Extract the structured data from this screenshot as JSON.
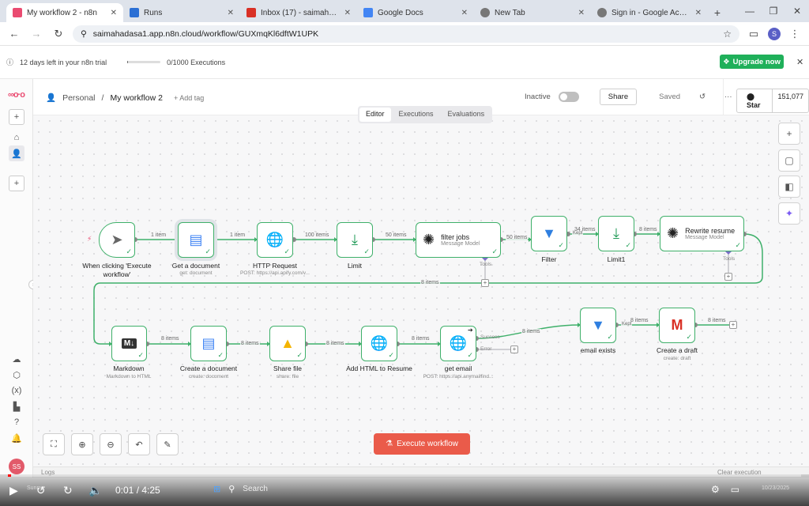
{
  "browser": {
    "tabs": [
      {
        "label": "My workflow 2 - n8n",
        "color": "#ea4b71",
        "active": true
      },
      {
        "label": "Runs",
        "color": "#2b6fd4",
        "active": false
      },
      {
        "label": "Inbox (17) - saimahadasa74",
        "color": "#d93025",
        "active": false
      },
      {
        "label": "Google Docs",
        "color": "#4285f4",
        "active": false
      },
      {
        "label": "New Tab",
        "color": "#777777",
        "active": false
      },
      {
        "label": "Sign in - Google Accounts",
        "color": "#777777",
        "active": false
      }
    ],
    "url": "saimahadasa1.app.n8n.cloud/workflow/GUXmqKl6dftW1UPK",
    "profile_initial": "S"
  },
  "trial": {
    "days_left": "12 days left in your n8n trial",
    "executions": "0/1000 Executions",
    "executions_fraction": 0.02,
    "upgrade_label": "Upgrade now"
  },
  "sidebar": {
    "logo": "n8n",
    "user_initials": "SS"
  },
  "header": {
    "project": "Personal",
    "workflow_name": "My workflow 2",
    "add_tag": "+ Add tag",
    "status": "Inactive",
    "share_label": "Share",
    "saved_label": "Saved",
    "github_star": "Star",
    "github_count": "151,077"
  },
  "mode_tabs": [
    "Editor",
    "Executions",
    "Evaluations"
  ],
  "nodes": {
    "trigger": {
      "label": "When clicking 'Execute workflow'"
    },
    "get_doc": {
      "label": "Get a document",
      "sub": "get: document"
    },
    "http": {
      "label": "HTTP Request",
      "sub": "POST: https://api.apify.com/v..."
    },
    "limit": {
      "label": "Limit"
    },
    "filter_jobs": {
      "title": "filter jobs",
      "sub": "Message Model",
      "tools": "Tools"
    },
    "filter": {
      "label": "Filter"
    },
    "limit1": {
      "label": "Limit1"
    },
    "rewrite": {
      "title": "Rewrite resume",
      "sub": "Message Model",
      "tools": "Tools"
    },
    "markdown": {
      "label": "Markdown",
      "sub": "Markdown to HTML"
    },
    "create_doc": {
      "label": "Create a document",
      "sub": "create: document"
    },
    "share_file": {
      "label": "Share file",
      "sub": "share: file"
    },
    "add_html": {
      "label": "Add HTML to Resume"
    },
    "get_email": {
      "label": "get email",
      "sub": "POST: https://api.anymailfind...",
      "out_success": "Success",
      "out_error": "Error"
    },
    "email_exists": {
      "label": "email exists"
    },
    "create_draft": {
      "label": "Create a draft",
      "sub": "create: draft"
    }
  },
  "edges": {
    "e1": "1 item",
    "e2": "1 item",
    "e3": "100 items",
    "e4": "50 items",
    "e5": "50 items",
    "e6": "34 items",
    "e6b": "Kept",
    "e7": "8 items",
    "e8": "8 items",
    "e9": "8 items",
    "e10": "8 items",
    "e11": "8 items",
    "e12": "8 items",
    "e13": "8 items",
    "e14": "8 items",
    "e14b": "Kept",
    "e15": "8 items"
  },
  "execute_label": "Execute workflow",
  "logs": {
    "label": "Logs",
    "clear": "Clear execution"
  },
  "player": {
    "time": "0:01 / 4:25",
    "progress_fraction": 0.004,
    "search": "Search",
    "weather": "Sunny",
    "clock_date": "10/23/2025"
  }
}
